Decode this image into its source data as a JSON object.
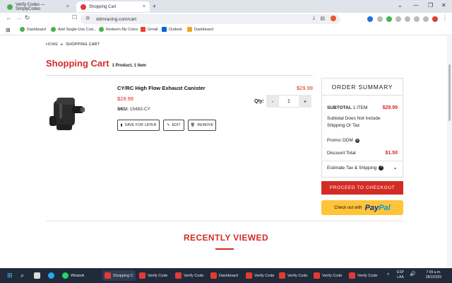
{
  "browser": {
    "tabs": [
      {
        "label": "Verify Codes — SimplyCodes",
        "active": false
      },
      {
        "label": "Shopping Cart",
        "active": true
      }
    ],
    "url": "ddmracing.com/cart",
    "bookmarks": [
      "Dashboard",
      "Add Single-Use Cod...",
      "Redeem My Coins",
      "Gmail",
      "Outlook",
      "Dashboard"
    ]
  },
  "page": {
    "breadcrumb": {
      "home": "HOME",
      "current": "SHOPPING CART"
    },
    "title": "Shopping Cart",
    "subtitle": "1 Product, 1 Item",
    "item": {
      "name": "CY/RC High Flow Exhaust Canister",
      "price": "$29.99",
      "sku_label": "SKU:",
      "sku": "15483-CY",
      "line_total": "$29.99",
      "qty_label": "Qty:",
      "qty": "1",
      "qty_minus": "-",
      "qty_plus": "+",
      "save_label": "SAVE FOR LATER",
      "edit_label": "EDIT",
      "remove_label": "REMOVE"
    },
    "summary": {
      "title": "ORDER SUMMARY",
      "subtotal_label": "SUBTOTAL",
      "subtotal_items": "1 ITEM",
      "subtotal_value": "$29.99",
      "subtotal_note": "Subtotal Does Not Include Shipping Or Tax",
      "promo_label": "Promo:",
      "promo_code": "DDM",
      "discount_label": "Discount Total",
      "discount_value": "$1.50",
      "estimate_label": "Estimate Tax & Shipping"
    },
    "checkout_label": "PROCEED TO CHECKOUT",
    "paypal": {
      "prefix": "Check out with",
      "brand_a": "Pay",
      "brand_b": "Pal"
    },
    "recently_viewed": "RECENTLY VIEWED"
  },
  "taskbar": {
    "apps": [
      "WhatsA",
      "Shopping C",
      "Verify Code",
      "Verify Code",
      "Dashboard",
      "Verify Code",
      "Verify Code",
      "Verify Code",
      "Verify Code"
    ],
    "lang": "ESP",
    "lang2": "LAA",
    "time": "7:09 a.m.",
    "date": "28/2/2025"
  },
  "colors": {
    "accent": "#d22c25",
    "paypal_yellow": "#ffc439",
    "paypal_blue": "#003087",
    "taskbar": "#202a3a"
  }
}
